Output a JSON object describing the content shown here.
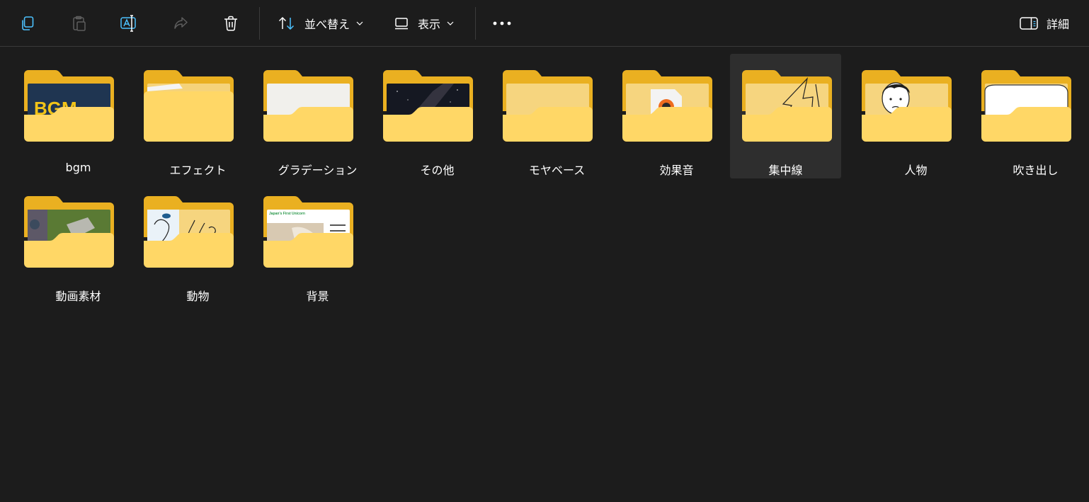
{
  "toolbar": {
    "copy_icon": "copy-icon",
    "paste_icon": "paste-icon",
    "rename_icon": "rename-icon",
    "share_icon": "share-icon",
    "delete_icon": "trash-icon",
    "sort_label": "並べ替え",
    "view_label": "表示",
    "more_icon": "more-horizontal-icon",
    "details_label": "詳細"
  },
  "folders": [
    {
      "name": "bgm",
      "preview": "bgm-logo-preview",
      "preview_text": "BGM"
    },
    {
      "name": "エフェクト",
      "preview": "paper-preview"
    },
    {
      "name": "グラデーション",
      "preview": "white-texture-preview"
    },
    {
      "name": "その他",
      "preview": "night-sky-preview"
    },
    {
      "name": "モヤベース",
      "preview": "empty"
    },
    {
      "name": "効果音",
      "preview": "audio-file-preview"
    },
    {
      "name": "集中線",
      "preview": "line-drawing-preview",
      "selected": true
    },
    {
      "name": "人物",
      "preview": "face-illustration-preview"
    },
    {
      "name": "吹き出し",
      "preview": "speech-bubble-preview"
    },
    {
      "name": "動画素材",
      "preview": "aerial-photo-preview"
    },
    {
      "name": "動物",
      "preview": "animal-illustration-preview"
    },
    {
      "name": "背景",
      "preview": "webpage-preview",
      "preview_text": "Japan's First Unicorn"
    }
  ],
  "colors": {
    "background": "#1c1c1c",
    "folder_back": "#eab021",
    "folder_front": "#ffd766",
    "accent": "#4cc2ff",
    "selected_bg": "#2e2e2e"
  }
}
